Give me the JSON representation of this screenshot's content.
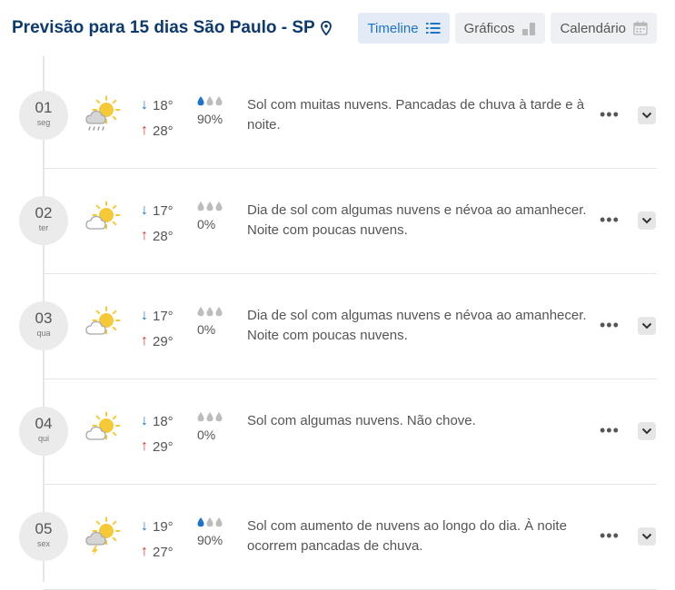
{
  "header": {
    "title": "Previsão para 15 dias São Paulo - SP",
    "location_icon": "location-pin-icon"
  },
  "tabs": [
    {
      "label": "Timeline",
      "icon": "list-icon",
      "active": true
    },
    {
      "label": "Gráficos",
      "icon": "bar-chart-icon",
      "active": false
    },
    {
      "label": "Calendário",
      "icon": "calendar-icon",
      "active": false
    }
  ],
  "colors": {
    "title": "#0d3a6e",
    "accent": "#1f74c7",
    "max": "#d9302b",
    "sun": "#f6c936"
  },
  "days": [
    {
      "num": "01",
      "name": "seg",
      "icon": "sun-cloud-rain-icon",
      "min": "18°",
      "max": "28°",
      "rain_drops": 1,
      "rain": "90%",
      "desc": "Sol com muitas nuvens. Pancadas de chuva à tarde e à noite."
    },
    {
      "num": "02",
      "name": "ter",
      "icon": "sun-cloud-icon",
      "min": "17°",
      "max": "28°",
      "rain_drops": 0,
      "rain": "0%",
      "desc": "Dia de sol com algumas nuvens e névoa ao amanhecer. Noite com poucas nuvens."
    },
    {
      "num": "03",
      "name": "qua",
      "icon": "sun-cloud-icon",
      "min": "17°",
      "max": "29°",
      "rain_drops": 0,
      "rain": "0%",
      "desc": "Dia de sol com algumas nuvens e névoa ao amanhecer. Noite com poucas nuvens."
    },
    {
      "num": "04",
      "name": "qui",
      "icon": "sun-cloud-icon",
      "min": "18°",
      "max": "29°",
      "rain_drops": 0,
      "rain": "0%",
      "desc": "Sol com algumas nuvens. Não chove."
    },
    {
      "num": "05",
      "name": "sex",
      "icon": "sun-cloud-storm-icon",
      "min": "19°",
      "max": "27°",
      "rain_drops": 1,
      "rain": "90%",
      "desc": "Sol com aumento de nuvens ao longo do dia. À noite ocorrem pancadas de chuva."
    }
  ],
  "row_actions": {
    "more_label": "•••"
  }
}
